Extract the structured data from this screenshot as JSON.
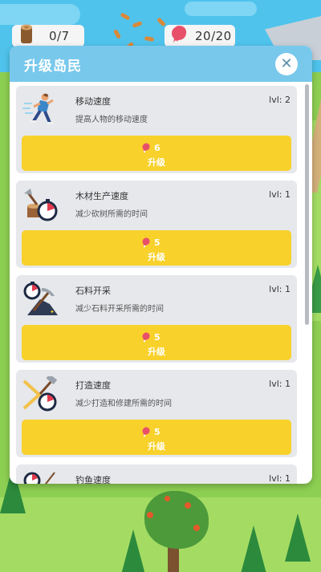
{
  "hud": {
    "wood": {
      "icon": "wood-log-icon",
      "count": "0/7"
    },
    "meat": {
      "icon": "meat-icon",
      "count": "20/20"
    }
  },
  "modal": {
    "title": "升级岛民",
    "close_icon": "close-icon"
  },
  "upgrades": [
    {
      "icon": "running-man-icon",
      "title": "移动速度",
      "description": "提高人物的移动速度",
      "level": "lvl: 2",
      "cost": "6",
      "button_label": "升级"
    },
    {
      "icon": "axe-stump-timer-icon",
      "title": "木材生产速度",
      "description": "减少砍树所需的时间",
      "level": "lvl: 1",
      "cost": "5",
      "button_label": "升级"
    },
    {
      "icon": "pickaxe-rock-timer-icon",
      "title": "石料开采",
      "description": "减少石料开采所需的时间",
      "level": "lvl: 1",
      "cost": "5",
      "button_label": "升级"
    },
    {
      "icon": "hammer-timer-icon",
      "title": "打造速度",
      "description": "减少打造和修建所需的时间",
      "level": "lvl: 1",
      "cost": "5",
      "button_label": "升级"
    },
    {
      "icon": "fishing-timer-icon",
      "title": "钓鱼速度",
      "description": "",
      "level": "lvl: 1",
      "cost": "",
      "button_label": ""
    }
  ],
  "colors": {
    "header": "#78c8ec",
    "button": "#f8d12b",
    "card": "#e6e8eb",
    "meat": "#e8506a"
  }
}
